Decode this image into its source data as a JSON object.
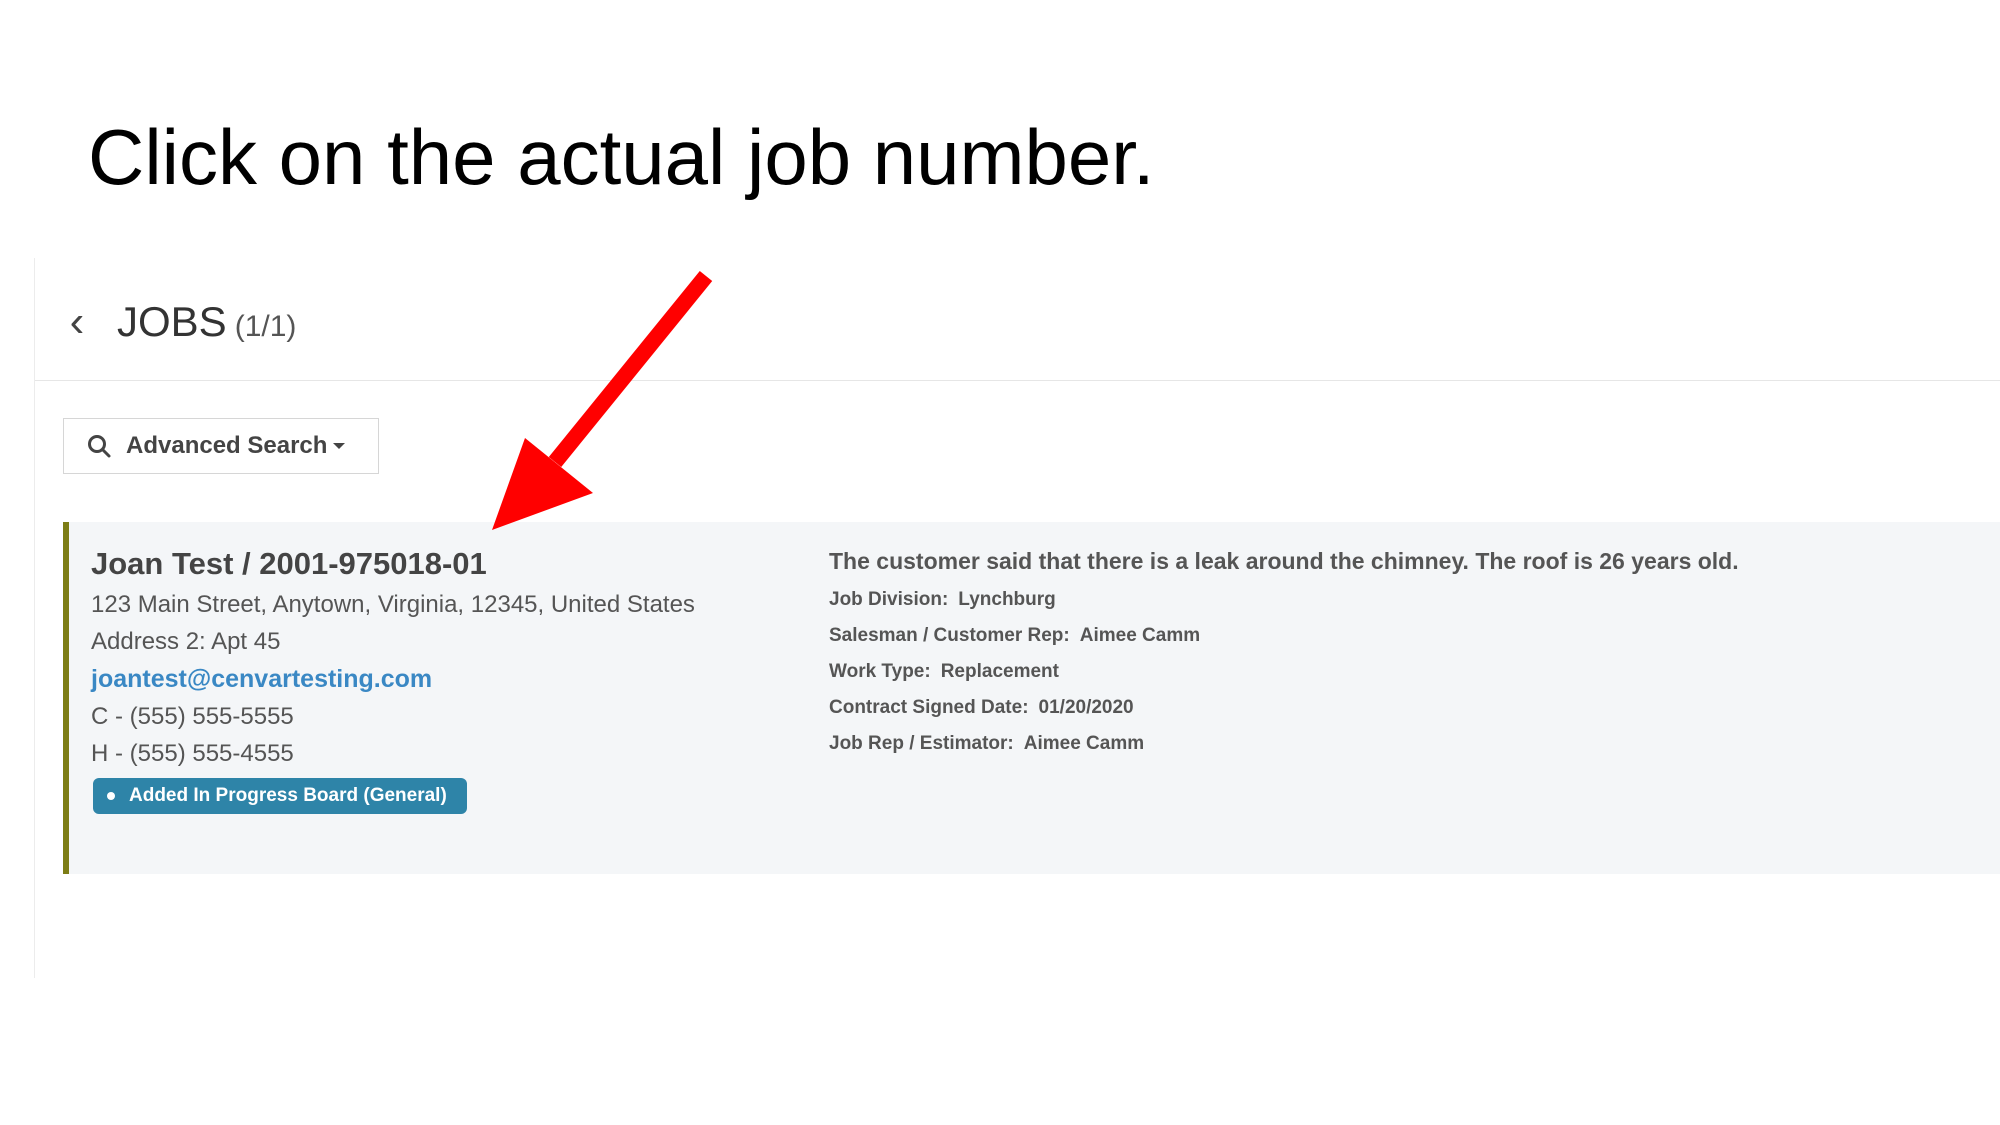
{
  "instruction": "Click on the actual job number.",
  "header": {
    "title": "JOBS",
    "count": "(1/1)"
  },
  "search": {
    "label": "Advanced Search"
  },
  "job": {
    "title": "Joan Test / 2001-975018-01",
    "address": "123 Main Street, Anytown, Virginia, 12345, United States",
    "address2": "Address 2: Apt 45",
    "email": "joantest@cenvartesting.com",
    "cell": "C - (555) 555-5555",
    "home": "H - (555) 555-4555",
    "badge": "Added In Progress Board (General)",
    "description": "The customer said that there is a leak around the chimney. The roof is 26 years old.",
    "details": [
      {
        "label": "Job Division:",
        "value": "Lynchburg"
      },
      {
        "label": "Salesman / Customer Rep:",
        "value": "Aimee Camm"
      },
      {
        "label": "Work Type:",
        "value": "Replacement"
      },
      {
        "label": "Contract Signed Date:",
        "value": "01/20/2020"
      },
      {
        "label": "Job Rep / Estimator:",
        "value": "Aimee Camm"
      }
    ]
  },
  "colors": {
    "arrow": "#ff0000",
    "badge": "#2e84a8",
    "email": "#3a88c4",
    "card_accent": "#7d7d15",
    "card_bg": "#f4f6f8"
  },
  "icons": [
    "chevron-left-icon",
    "search-icon",
    "red-arrow-icon"
  ]
}
